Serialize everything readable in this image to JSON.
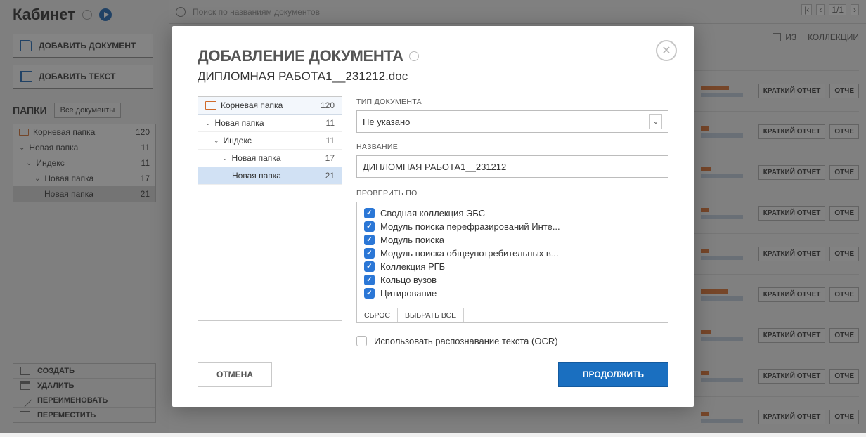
{
  "sidebar": {
    "title": "Кабинет",
    "add_document_label": "ДОБАВИТЬ ДОКУМЕНТ",
    "add_text_label": "ДОБАВИТЬ ТЕКСТ",
    "section_label": "ПАПКИ",
    "all_docs_label": "Все документы",
    "folders": [
      {
        "name": "Корневая папка",
        "count": 120,
        "indent": 0,
        "icon": true
      },
      {
        "name": "Новая папка",
        "count": 11,
        "indent": 0
      },
      {
        "name": "Индекс",
        "count": 11,
        "indent": 1
      },
      {
        "name": "Новая папка",
        "count": 17,
        "indent": 2
      },
      {
        "name": "Новая папка",
        "count": 21,
        "indent": 3,
        "selected": true
      }
    ],
    "actions": {
      "create": "СОЗДАТЬ",
      "delete": "УДАЛИТЬ",
      "rename": "ПЕРЕИМЕНОВАТЬ",
      "move": "ПЕРЕМЕСТИТЬ"
    }
  },
  "main": {
    "search_placeholder": "Поиск по названиям документов",
    "pager": {
      "first": "|‹",
      "prev": "‹",
      "value": "1/1",
      "next": "›"
    },
    "tabs": {
      "from": "ИЗ",
      "collections": "КОЛЛЕКЦИИ"
    },
    "brief_label": "КРАТКИЙ ОТЧЕТ",
    "report_label": "ОТЧЕ"
  },
  "modal": {
    "title": "ДОБАВЛЕНИЕ ДОКУМЕНТА",
    "filename": "ДИПЛОМНАЯ РАБОТА1__231212.doc",
    "tree": [
      {
        "name": "Корневая папка",
        "count": 120,
        "root": true
      },
      {
        "name": "Новая папка",
        "count": 11,
        "indent": 0
      },
      {
        "name": "Индекс",
        "count": 11,
        "indent": 1
      },
      {
        "name": "Новая папка",
        "count": 17,
        "indent": 2
      },
      {
        "name": "Новая папка",
        "count": 21,
        "indent": 3,
        "selected": true
      }
    ],
    "doc_type_label": "ТИП ДОКУМЕНТА",
    "doc_type_value": "Не указано",
    "name_label": "НАЗВАНИЕ",
    "name_value": "ДИПЛОМНАЯ РАБОТА1__231212",
    "check_label": "ПРОВЕРИТЬ ПО",
    "check_modules": [
      "Сводная коллекция ЭБС",
      "Модуль поиска перефразирований Инте...",
      "Модуль поиска",
      "Модуль поиска общеупотребительных в...",
      "Коллекция РГБ",
      "Кольцо вузов",
      "Цитирование"
    ],
    "reset_label": "СБРОС",
    "select_all_label": "ВЫБРАТЬ ВСЕ",
    "ocr_label": "Использовать распознавание текста (OCR)",
    "cancel_label": "ОТМЕНА",
    "continue_label": "ПРОДОЛЖИТЬ"
  }
}
